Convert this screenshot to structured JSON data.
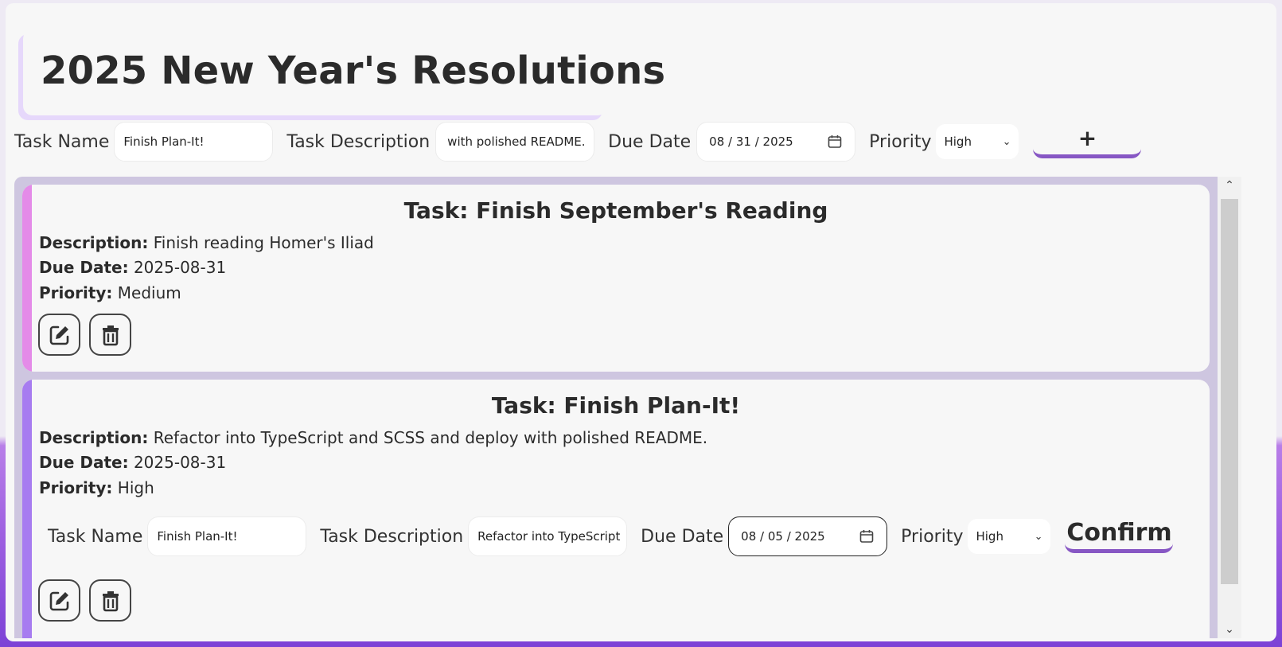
{
  "page": {
    "title": "2025 New Year's Resolutions"
  },
  "form": {
    "task_name_label": "Task Name",
    "task_name_value": "Finish Plan-It!",
    "task_desc_label": "Task Description",
    "task_desc_value": "with polished README.",
    "due_date_label": "Due Date",
    "due_date_value": "08 / 31 / 2025",
    "priority_label": "Priority",
    "priority_value": "High",
    "add_label": "+"
  },
  "tasks": [
    {
      "title": "Task: Finish September's Reading",
      "desc_label": "Description:",
      "desc": "Finish reading Homer's Iliad",
      "due_label": "Due Date:",
      "due": "2025-08-31",
      "priority_label": "Priority:",
      "priority": "Medium",
      "accent": "#e48be8"
    },
    {
      "title": "Task: Finish Plan-It!",
      "desc_label": "Description:",
      "desc": "Refactor into TypeScript and SCSS and deploy with polished README.",
      "due_label": "Due Date:",
      "due": "2025-08-31",
      "priority_label": "Priority:",
      "priority": "High",
      "accent": "#a77cf0",
      "edit_form": {
        "task_name_label": "Task Name",
        "task_name_value": "Finish Plan-It!",
        "task_desc_label": "Task Description",
        "task_desc_value": "Refactor into TypeScript",
        "due_date_label": "Due Date",
        "due_date_value": "08 / 05 / 2025",
        "priority_label": "Priority",
        "priority_value": "High",
        "confirm_label": "Confirm"
      }
    }
  ],
  "icons": {
    "edit": "edit-icon",
    "delete": "trash-icon",
    "calendar": "calendar-icon",
    "chevron": "chevron-down-icon"
  },
  "colors": {
    "accent_purple": "#8757c4",
    "list_bg": "#cec6e0",
    "title_shadow": "#e6d8fb"
  }
}
